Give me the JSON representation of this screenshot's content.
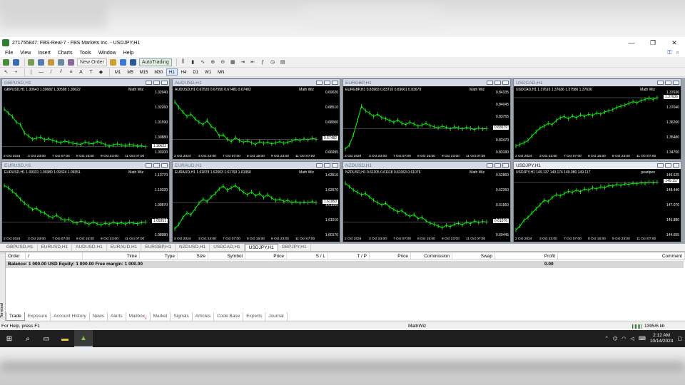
{
  "window": {
    "title": "271755847: FBS-Real-7 - FBS Markets Inc. - USDJPY,H1",
    "minimize": "—",
    "maximize": "❐",
    "close": "✕"
  },
  "menu": {
    "items": [
      "File",
      "View",
      "Insert",
      "Charts",
      "Tools",
      "Window",
      "Help"
    ],
    "right_icons": [
      "key-icon",
      "search-icon"
    ]
  },
  "toolbar": {
    "new_order": "New Order",
    "autotrading": "AutoTrading",
    "timeframes": [
      "M1",
      "M5",
      "M15",
      "M30",
      "H1",
      "H4",
      "D1",
      "W1",
      "MN"
    ],
    "active_timeframe": "H1",
    "draw_tools": [
      "cursor",
      "crosshair",
      "vertical-line",
      "horizontal-line",
      "trendline",
      "channel",
      "fibo",
      "text",
      "label",
      "shapes"
    ]
  },
  "charts": [
    {
      "tab": "GBPUSD,H1",
      "info": "GBPUSD,H1  1.30643 1.30682 1.30598 1.30622",
      "mathwiz": "Math Wiz",
      "yticks": [
        "1.32940",
        "1.32260",
        "1.31590",
        "1.30880",
        "1.30200"
      ],
      "price": "1.30622",
      "xticks": [
        "2 Oct 2024",
        "3 Oct 23:00",
        "7 Oct 07:00",
        "8 Oct 15:00",
        "9 Oct 23:00",
        "11 Oct 07:00"
      ],
      "series": [
        0.75,
        0.68,
        0.62,
        0.52,
        0.48,
        0.33,
        0.28,
        0.22,
        0.24,
        0.26,
        0.21,
        0.23,
        0.2,
        0.18,
        0.16,
        0.19,
        0.17,
        0.15,
        0.14,
        0.13,
        0.17,
        0.15,
        0.14,
        0.18,
        0.16,
        0.13,
        0.1,
        0.12,
        0.14,
        0.12,
        0.11,
        0.13,
        0.12,
        0.1,
        0.11,
        0.09
      ]
    },
    {
      "tab": "AUDUSD,H1",
      "info": "AUDUSD,H1  0.67535 0.67556 0.67481 0.67482",
      "mathwiz": "Math Wiz",
      "yticks": [
        "0.69020",
        "0.68510",
        "0.68000",
        "0.67482",
        "0.66995"
      ],
      "price": "0.67482",
      "xticks": [
        "2 Oct 2024",
        "3 Oct 23:00",
        "7 Oct 07:00",
        "8 Oct 15:00",
        "9 Oct 23:00",
        "11 Oct 07:00"
      ],
      "series": [
        0.88,
        0.78,
        0.7,
        0.62,
        0.66,
        0.58,
        0.52,
        0.48,
        0.55,
        0.45,
        0.4,
        0.28,
        0.3,
        0.22,
        0.18,
        0.25,
        0.2,
        0.17,
        0.19,
        0.16,
        0.13,
        0.18,
        0.15,
        0.17,
        0.14,
        0.16,
        0.18,
        0.15,
        0.17,
        0.19,
        0.22,
        0.2,
        0.23,
        0.21,
        0.24,
        0.22
      ]
    },
    {
      "tab": "EURGBP,H1",
      "info": "EURGBP,H1  0.83683 0.83710 0.83661 0.83679",
      "mathwiz": "Math Wiz",
      "yticks": [
        "0.84335",
        "0.84045",
        "0.83755",
        "0.83679",
        "0.83470",
        "0.83180"
      ],
      "price": "0.83679",
      "xticks": [
        "2 Oct 2024",
        "3 Oct 23:00",
        "7 Oct 07:00",
        "8 Oct 15:00",
        "9 Oct 23:00",
        "11 Oct 07:00"
      ],
      "series": [
        0.05,
        0.12,
        0.3,
        0.55,
        0.8,
        0.72,
        0.68,
        0.62,
        0.66,
        0.6,
        0.58,
        0.55,
        0.52,
        0.56,
        0.5,
        0.48,
        0.52,
        0.49,
        0.45,
        0.47,
        0.5,
        0.46,
        0.44,
        0.42,
        0.45,
        0.43,
        0.4,
        0.44,
        0.42,
        0.4,
        0.43,
        0.41,
        0.39,
        0.42,
        0.4,
        0.41
      ]
    },
    {
      "tab": "USDCAD,H1",
      "info": "USDCAD,H1  1.37616 1.37636 1.37586 1.37636",
      "mathwiz": "Math Wiz",
      "yticks": [
        "1.37636",
        "1.37040",
        "1.36260",
        "1.35480",
        "1.34700"
      ],
      "price": "1.37636",
      "xticks": [
        "2 Oct 2024",
        "3 Oct 23:00",
        "7 Oct 07:00",
        "8 Oct 15:00",
        "9 Oct 23:00",
        "11 Oct 07:00"
      ],
      "series": [
        0.1,
        0.13,
        0.16,
        0.2,
        0.28,
        0.35,
        0.42,
        0.45,
        0.5,
        0.48,
        0.55,
        0.6,
        0.62,
        0.58,
        0.63,
        0.6,
        0.65,
        0.62,
        0.66,
        0.64,
        0.68,
        0.66,
        0.7,
        0.72,
        0.74,
        0.78,
        0.8,
        0.82,
        0.85,
        0.88,
        0.86,
        0.9,
        0.92,
        0.94,
        0.92,
        0.95
      ]
    },
    {
      "tab": "EURUSD,H1",
      "info": "EURUSD,H1  1.09331 1.09380 1.09324 1.09351",
      "mathwiz": "Math Wiz",
      "yticks": [
        "1.10770",
        "1.10320",
        "1.09870",
        "1.09351",
        "1.08980"
      ],
      "price": "1.09351",
      "xticks": [
        "2 Oct 2024",
        "3 Oct 23:00",
        "7 Oct 07:00",
        "8 Oct 15:00",
        "9 Oct 23:00",
        "11 Oct 07:00"
      ],
      "series": [
        0.86,
        0.82,
        0.76,
        0.7,
        0.62,
        0.55,
        0.5,
        0.44,
        0.46,
        0.4,
        0.38,
        0.32,
        0.3,
        0.34,
        0.28,
        0.25,
        0.27,
        0.22,
        0.2,
        0.24,
        0.21,
        0.18,
        0.22,
        0.19,
        0.17,
        0.2,
        0.18,
        0.22,
        0.19,
        0.21,
        0.18,
        0.22,
        0.2,
        0.19,
        0.21,
        0.22
      ]
    },
    {
      "tab": "EURAUD,H1",
      "info": "EURAUD,H1  1.61878 1.62003 1.61793 1.61950",
      "mathwiz": "Math Wiz",
      "yticks": [
        "1.63510",
        "1.62670",
        "1.61950",
        "1.61010",
        "1.60170"
      ],
      "price": "1.61950",
      "xticks": [
        "2 Oct 2024",
        "3 Oct 23:00",
        "7 Oct 07:00",
        "8 Oct 15:00",
        "9 Oct 23:00",
        "11 Oct 07:00"
      ],
      "series": [
        0.1,
        0.18,
        0.3,
        0.38,
        0.35,
        0.45,
        0.55,
        0.62,
        0.58,
        0.66,
        0.72,
        0.8,
        0.85,
        0.78,
        0.82,
        0.86,
        0.8,
        0.74,
        0.7,
        0.75,
        0.68,
        0.72,
        0.65,
        0.7,
        0.64,
        0.6,
        0.62,
        0.58,
        0.6,
        0.56,
        0.58,
        0.55,
        0.57,
        0.56,
        0.58,
        0.56
      ]
    },
    {
      "tab": "NZDUSD,H1",
      "info": "NZDUSD,H1  0.61105 0.61118 0.61063 0.61076",
      "mathwiz": "Math Wiz",
      "yticks": [
        "0.62860",
        "0.62260",
        "0.61660",
        "0.61076",
        "0.60445"
      ],
      "price": "0.61076",
      "xticks": [
        "2 Oct 2024",
        "3 Oct 23:00",
        "7 Oct 07:00",
        "8 Oct 15:00",
        "9 Oct 23:00",
        "11 Oct 07:00"
      ],
      "series": [
        0.9,
        0.84,
        0.78,
        0.74,
        0.7,
        0.72,
        0.66,
        0.6,
        0.56,
        0.52,
        0.55,
        0.48,
        0.44,
        0.4,
        0.42,
        0.36,
        0.32,
        0.35,
        0.28,
        0.3,
        0.24,
        0.2,
        0.18,
        0.15,
        0.12,
        0.16,
        0.14,
        0.18,
        0.2,
        0.17,
        0.22,
        0.19,
        0.24,
        0.21,
        0.23,
        0.22
      ]
    },
    {
      "tab": "USDJPY,H1",
      "info": "USDJPY,H1  149.137 149.174 149.080 149.117",
      "mathwiz": "pearlpen",
      "yticks": [
        "149.625",
        "148.440",
        "147.070",
        "145.880",
        "144.655"
      ],
      "price": "149.117",
      "xticks": [
        "2 Oct 2024",
        "3 Oct 23:00",
        "7 Oct 07:00",
        "8 Oct 15:00",
        "9 Oct 23:00",
        "11 Oct 07:00"
      ],
      "series": [
        0.08,
        0.15,
        0.25,
        0.3,
        0.38,
        0.45,
        0.52,
        0.6,
        0.58,
        0.65,
        0.7,
        0.68,
        0.72,
        0.76,
        0.74,
        0.78,
        0.75,
        0.8,
        0.78,
        0.82,
        0.8,
        0.84,
        0.82,
        0.86,
        0.85,
        0.88,
        0.86,
        0.89,
        0.88,
        0.9,
        0.89,
        0.91,
        0.9,
        0.92,
        0.91,
        0.92
      ]
    }
  ],
  "chart_tabs": [
    "GBPUSD,H1",
    "EURUSD,H1",
    "AUDUSD,H1",
    "EURAUD,H1",
    "EURGBP,H1",
    "NZDUSD,H1",
    "USDCAD,H1",
    "USDJPY,H1",
    "GBPJPY,H1"
  ],
  "active_chart_tab": "USDJPY,H1",
  "terminal": {
    "side_label": "Terminal",
    "columns": [
      "Order",
      "/",
      "Time",
      "Type",
      "Size",
      "Symbol",
      "Price",
      "S / L",
      "T / P",
      "Price",
      "Commission",
      "Swap",
      "Profit",
      "Comment"
    ],
    "balance_line": "Balance: 1 000.00 USD  Equity: 1 000.00  Free margin: 1 000.00",
    "profit": "0.00",
    "tabs": [
      "Trade",
      "Exposure",
      "Account History",
      "News",
      "Alerts",
      "Mailbox",
      "Market",
      "Signals",
      "Articles",
      "Code Base",
      "Experts",
      "Journal"
    ],
    "mailbox_count": "2"
  },
  "status": {
    "help": "For Help, press F1",
    "profile": "MathWiz",
    "traffic": "1395/6 kb"
  },
  "taskbar": {
    "time": "2:12 AM",
    "date": "10/14/2024"
  }
}
